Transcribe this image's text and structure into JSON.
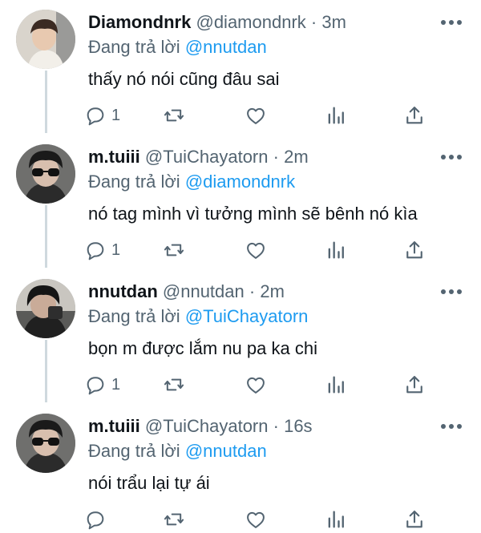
{
  "tweets": [
    {
      "name": "Diamondnrk",
      "handle": "@diamondnrk",
      "separator": "·",
      "time": "3m",
      "replying_prefix": "Đang trả lời",
      "replying_to": "@nnutdan",
      "text": "thấy nó nói cũng đâu sai",
      "reply_count": "1",
      "avatar_icon": "avatar-user-photo"
    },
    {
      "name": "m.tuiii",
      "handle": "@TuiChayatorn",
      "separator": "·",
      "time": "2m",
      "replying_prefix": "Đang trả lời",
      "replying_to": "@diamondnrk",
      "text": "nó tag mình vì tưởng mình sẽ bênh nó kìa",
      "reply_count": "1",
      "avatar_icon": "avatar-user-photo"
    },
    {
      "name": "nnutdan",
      "handle": "@nnutdan",
      "separator": "·",
      "time": "2m",
      "replying_prefix": "Đang trả lời",
      "replying_to": "@TuiChayatorn",
      "text": "bọn m được lắm nu pa ka chi",
      "reply_count": "1",
      "avatar_icon": "avatar-user-photo"
    },
    {
      "name": "m.tuiii",
      "handle": "@TuiChayatorn",
      "separator": "·",
      "time": "16s",
      "replying_prefix": "Đang trả lời",
      "replying_to": "@nnutdan",
      "text": "nói trẩu lại tự ái",
      "reply_count": "",
      "avatar_icon": "avatar-user-photo"
    }
  ],
  "colors": {
    "text": "#0f1419",
    "secondary": "#536471",
    "link": "#1d9bf0",
    "thread_line": "#cfd9de"
  },
  "icons": [
    "comment-icon",
    "retweet-icon",
    "like-icon",
    "stats-icon",
    "share-icon",
    "more-icon"
  ]
}
